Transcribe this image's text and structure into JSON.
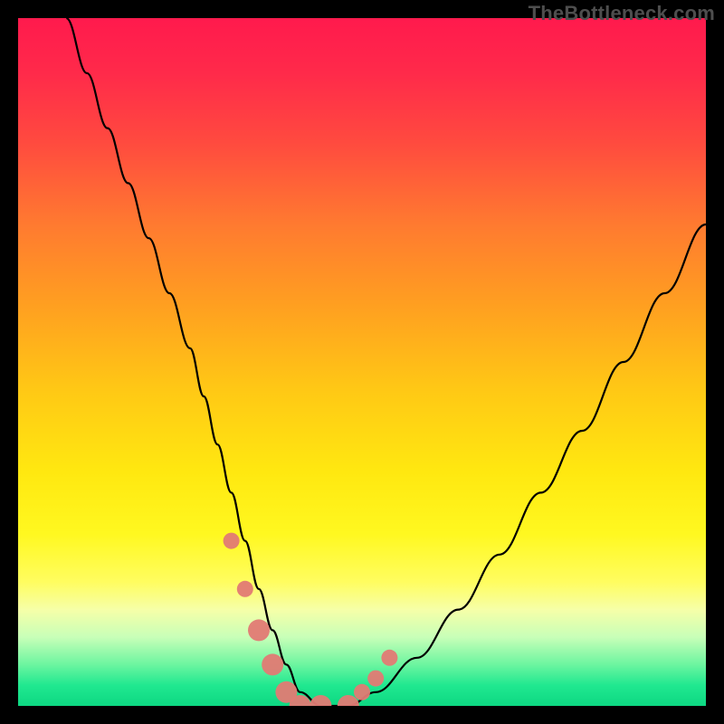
{
  "watermark": "TheBottleneck.com",
  "chart_data": {
    "type": "line",
    "title": "",
    "xlabel": "",
    "ylabel": "",
    "xlim": [
      0,
      100
    ],
    "ylim": [
      0,
      100
    ],
    "series": [
      {
        "name": "bottleneck-curve",
        "x": [
          7,
          10,
          13,
          16,
          19,
          22,
          25,
          27,
          29,
          31,
          33,
          35,
          37,
          39,
          41,
          44,
          48,
          52,
          58,
          64,
          70,
          76,
          82,
          88,
          94,
          100
        ],
        "values": [
          100,
          92,
          84,
          76,
          68,
          60,
          52,
          45,
          38,
          31,
          24,
          17,
          11,
          6,
          2,
          0,
          0,
          2,
          7,
          14,
          22,
          31,
          40,
          50,
          60,
          70
        ]
      }
    ],
    "markers": {
      "name": "highlight-points",
      "x": [
        31,
        33,
        35,
        37,
        39,
        41,
        44,
        48,
        50,
        52,
        54
      ],
      "values": [
        24,
        17,
        11,
        6,
        2,
        0,
        0,
        0,
        2,
        4,
        7
      ],
      "sizes": [
        9,
        9,
        12,
        12,
        12,
        12,
        12,
        12,
        9,
        9,
        9
      ],
      "color": "#e27a74"
    },
    "colors": {
      "curve": "#000000",
      "gradient_top": "#ff1a4d",
      "gradient_mid": "#ffe810",
      "gradient_bottom": "#0dd882"
    }
  }
}
